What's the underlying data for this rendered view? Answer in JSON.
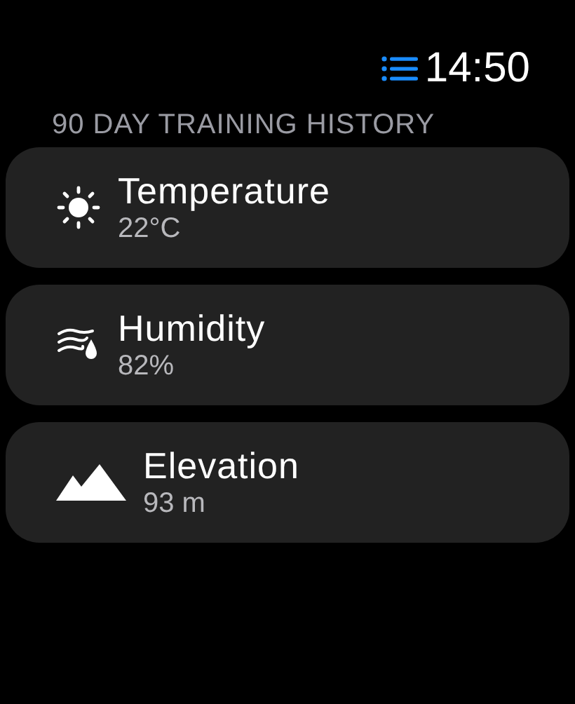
{
  "status_bar": {
    "time": "14:50"
  },
  "section_header": "90 DAY TRAINING HISTORY",
  "items": [
    {
      "kind": "sun",
      "title": "Temperature",
      "value": "22°C"
    },
    {
      "kind": "humidity",
      "title": "Humidity",
      "value": "82%"
    },
    {
      "kind": "mountains",
      "title": "Elevation",
      "value": "93 m"
    }
  ]
}
